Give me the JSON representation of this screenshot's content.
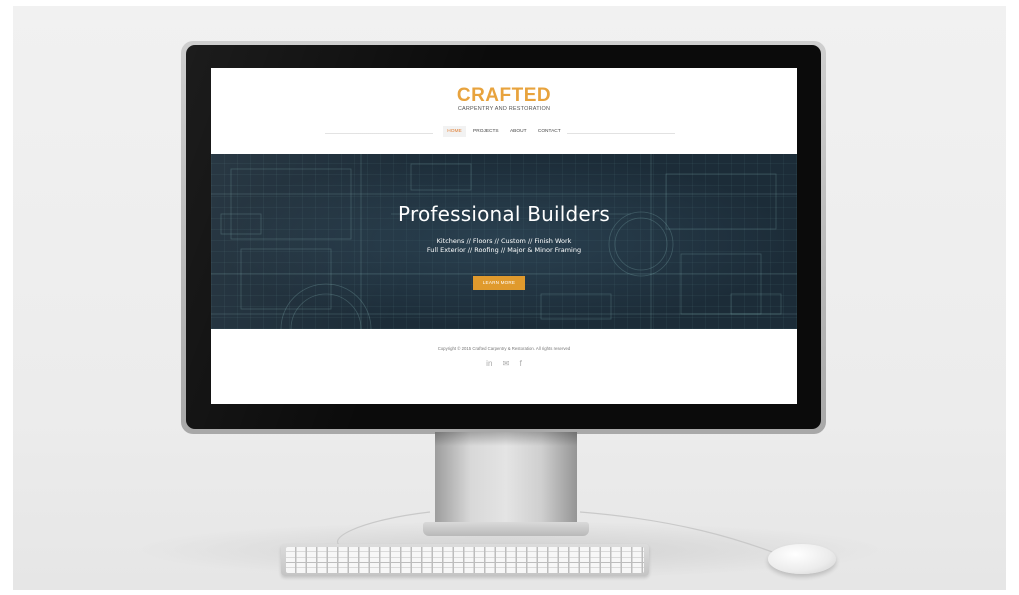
{
  "site": {
    "logo_title": "CRAFTED",
    "logo_subtitle": "CARPENTRY AND RESTORATION",
    "nav": [
      {
        "label": "HOME",
        "active": true
      },
      {
        "label": "PROJECTS",
        "active": false
      },
      {
        "label": "ABOUT",
        "active": false
      },
      {
        "label": "CONTACT",
        "active": false
      }
    ],
    "hero": {
      "title": "Professional Builders",
      "line1": "Kitchens // Floors // Custom // Finish Work",
      "line2": "Full Exterior // Roofing // Major & Minor Framing",
      "button_label": "LEARN MORE"
    },
    "footer": {
      "copyright": "Copyright © 2015 Crafted Carpentry & Restoration. All rights reserved",
      "socials": [
        {
          "icon": "linkedin-icon",
          "glyph": "in"
        },
        {
          "icon": "mail-icon",
          "glyph": "✉"
        },
        {
          "icon": "facebook-icon",
          "glyph": "f"
        }
      ]
    }
  },
  "colors": {
    "accent": "#e8a33d",
    "button": "#e09a2d",
    "nav_active": "#e07a2c",
    "hero_background": "#1c2c38"
  }
}
